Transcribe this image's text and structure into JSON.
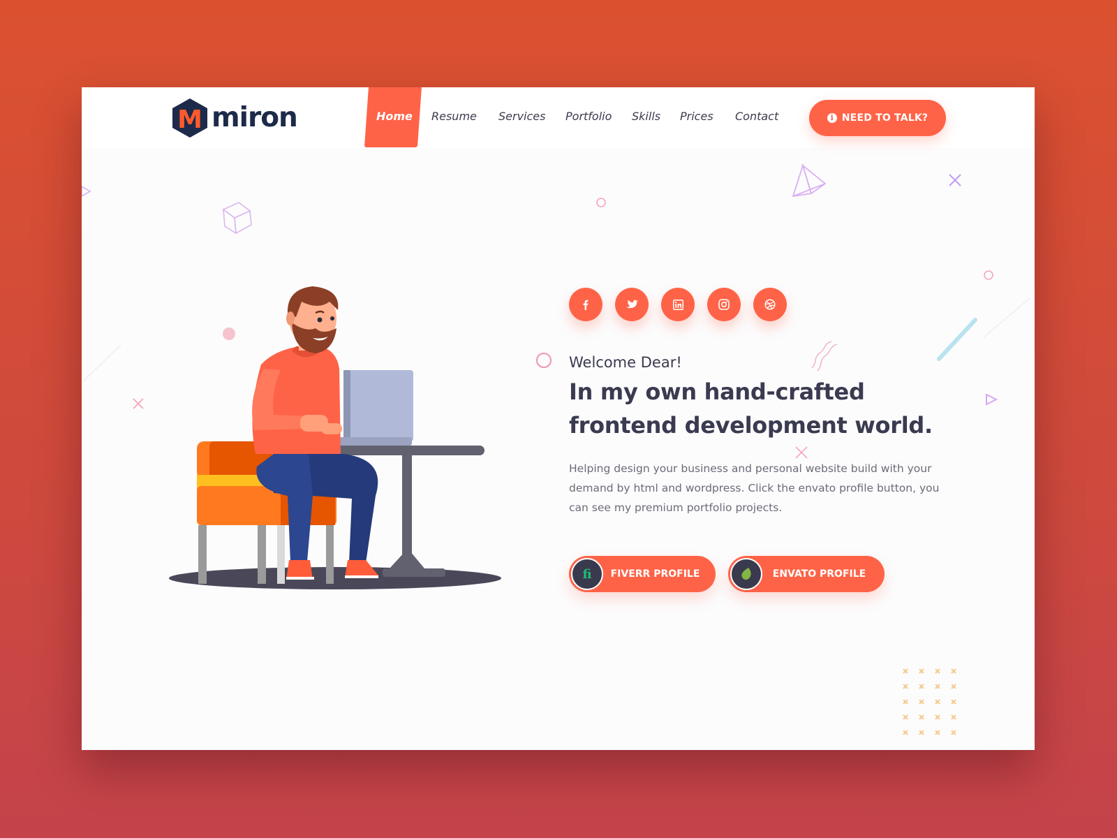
{
  "logo": {
    "letter": "M",
    "text": "miron"
  },
  "nav": {
    "items": [
      {
        "label": "Home",
        "active": true
      },
      {
        "label": "Resume"
      },
      {
        "label": "Services"
      },
      {
        "label": "Portfolio"
      },
      {
        "label": "Skills"
      },
      {
        "label": "Prices"
      },
      {
        "label": "Contact"
      }
    ]
  },
  "cta": {
    "icon": "info-icon",
    "icon_glyph": "i",
    "label": "NEED TO TALK?"
  },
  "socials": [
    {
      "icon": "facebook-icon"
    },
    {
      "icon": "twitter-icon"
    },
    {
      "icon": "linkedin-icon"
    },
    {
      "icon": "instagram-icon"
    },
    {
      "icon": "dribbble-icon"
    }
  ],
  "hero": {
    "welcome": "Welcome Dear!",
    "headline_line1": "In my own hand-crafted",
    "headline_line2": "frontend development world.",
    "description": "Helping design your business and personal website build with your demand by html and wordpress. Click the envato profile button, you can see my premium portfolio projects."
  },
  "buttons": {
    "fiverr": {
      "label": "FIVERR PROFILE",
      "icon": "fiverr-icon",
      "icon_glyph": "fi"
    },
    "envato": {
      "label": "ENVATO PROFILE",
      "icon": "envato-leaf-icon"
    }
  },
  "colors": {
    "accent": "#ff6347",
    "text_dark": "#3a3a50",
    "logo_navy": "#1d2a4a",
    "background_top": "#db5130",
    "background_bottom": "#c4434b"
  }
}
